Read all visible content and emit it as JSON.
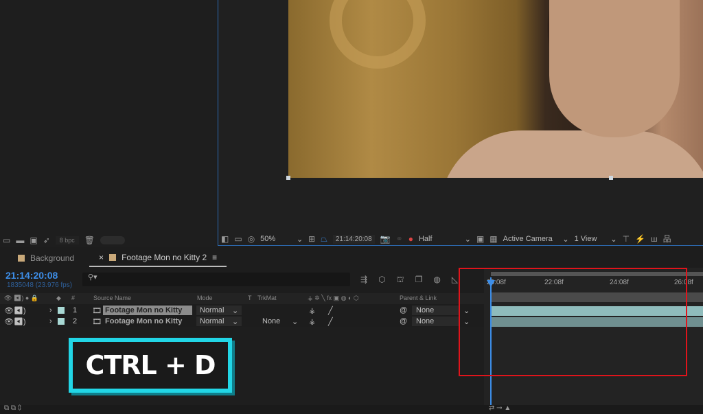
{
  "project_panel": {
    "bpc_label": "8 bpc"
  },
  "viewer": {
    "zoom": "50%",
    "timecode": "21:14:20:08",
    "resolution": "Half",
    "camera": "Active Camera",
    "views": "1 View"
  },
  "tabs": [
    {
      "label": "Background",
      "color": "#c9a97a"
    },
    {
      "label": "Footage Mon no Kitty 2",
      "color": "#c9a97a",
      "active": true
    }
  ],
  "timeline": {
    "current_time": "21:14:20:08",
    "frame_info": "1835048 (23.976 fps)",
    "search_placeholder": "",
    "columns": {
      "num": "#",
      "source_name": "Source Name",
      "mode": "Mode",
      "t": "T",
      "trkmat": "TrkMat",
      "parent": "Parent & Link"
    },
    "layers": [
      {
        "num": "1",
        "name": "Footage Mon no Kitty",
        "mode": "Normal",
        "trkmat": "",
        "parent": "None",
        "color": "#a8d8d4",
        "selected": true
      },
      {
        "num": "2",
        "name": "Footage Mon no Kitty",
        "mode": "Normal",
        "trkmat": "None",
        "parent": "None",
        "color": "#a8d8d4",
        "selected": false
      }
    ],
    "ruler": [
      "20:08f",
      "22:08f",
      "24:08f",
      "26:08f"
    ]
  },
  "overlay": {
    "shortcut": "CTRL + D",
    "highlight_color": "#e0141b",
    "badge_color": "#22d6e6"
  }
}
